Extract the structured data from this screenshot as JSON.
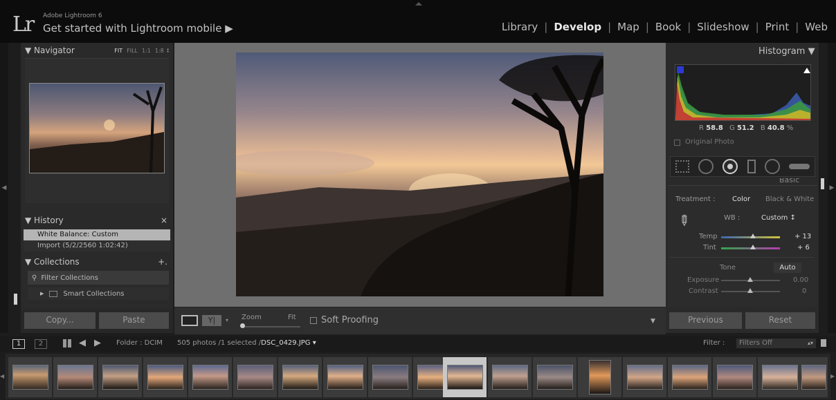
{
  "app": {
    "logo": "Lr",
    "name": "Adobe Lightroom 6",
    "mobile": "Get started with Lightroom mobile ▶"
  },
  "modules": [
    "Library",
    "Develop",
    "Map",
    "Book",
    "Slideshow",
    "Print",
    "Web"
  ],
  "active_module": "Develop",
  "navigator": {
    "title": "▼ Navigator",
    "zoom": [
      "FIT",
      "FILL",
      "1:1",
      "1:8 ↕"
    ]
  },
  "history": {
    "title": "▼ History",
    "close": "×",
    "items": [
      "White Balance: Custom",
      "Import (5/2/2560 1:02:42)"
    ]
  },
  "collections": {
    "title": "▼ Collections",
    "add": "+.",
    "filter": "Filter Collections",
    "smart": "Smart Collections"
  },
  "left_buttons": {
    "copy": "Copy...",
    "paste": "Paste"
  },
  "toolbar": {
    "zoom": "Zoom",
    "fit": "Fit",
    "soft_proofing": "Soft Proofing"
  },
  "histogram": {
    "title": "Histogram ▼",
    "r_label": "R",
    "r": "58.8",
    "g_label": "G",
    "g": "51.2",
    "b_label": "B",
    "b": "40.8",
    "percent": "%",
    "original": "Original Photo"
  },
  "basic": {
    "title": "Basic",
    "treatment_label": "Treatment :",
    "color": "Color",
    "bw": "Black & White",
    "wb_label": "WB :",
    "wb_value": "Custom ↕",
    "temp_label": "Temp",
    "temp_value": "+ 13",
    "tint_label": "Tint",
    "tint_value": "+ 6",
    "tone_label": "Tone",
    "auto": "Auto",
    "exposure_label": "Exposure",
    "exposure_value": "0.00",
    "contrast_label": "Contrast",
    "contrast_value": "0"
  },
  "right_buttons": {
    "previous": "Previous",
    "reset": "Reset"
  },
  "filmbar": {
    "page1": "1",
    "page2": "2",
    "folder": "Folder : DCIM",
    "count": "505 photos /1 selected /",
    "filename": "DSC_0429.JPG ▾",
    "filter_label": "Filter :",
    "filter_value": "Filters Off"
  },
  "colors": {
    "accent": "#eaeaea",
    "panel": "#2a2a2a",
    "selected_row": "#b5b5b5"
  }
}
